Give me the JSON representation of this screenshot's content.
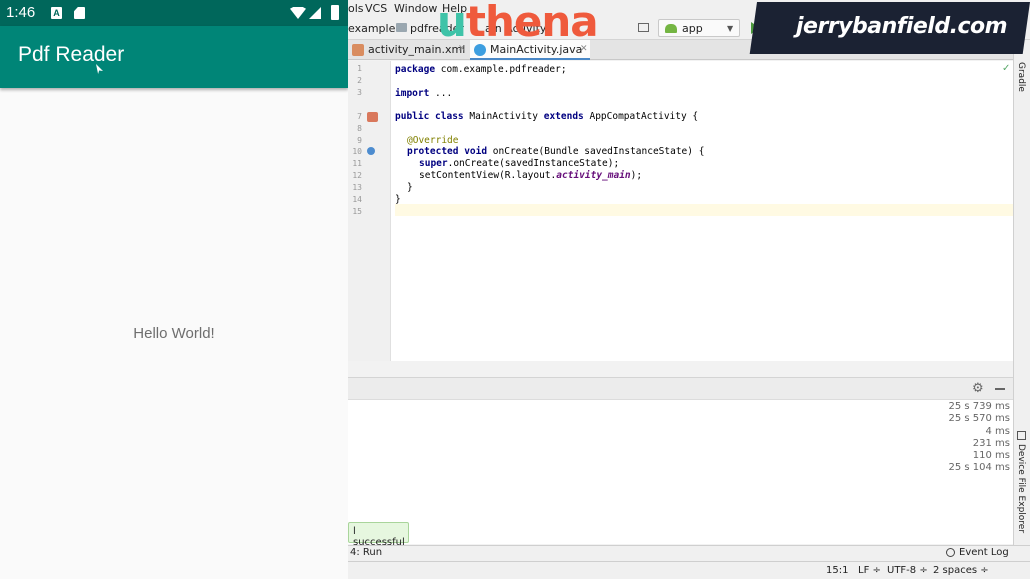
{
  "phone": {
    "time": "1:46",
    "status_a": "A",
    "app_title": "Pdf Reader",
    "hello_text": "Hello World!"
  },
  "ide": {
    "menu": [
      "ols",
      "VCS",
      "Window",
      "Help"
    ],
    "breadcrumbs": [
      "example",
      "pdfreader",
      "ain Activity"
    ],
    "run_config": "app",
    "tabs": [
      {
        "label": "activity_main.xml"
      },
      {
        "label": "MainActivity.java"
      }
    ],
    "line_numbers": [
      "1",
      "2",
      "3",
      "7",
      "8",
      "9",
      "10",
      "11",
      "12",
      "13",
      "14",
      "15"
    ],
    "code": {
      "l1_kw": "package",
      "l1_rest": " com.example.pdfreader;",
      "l3_kw": "import",
      "l3_rest": " ...",
      "l7_kw1": "public class",
      "l7_mid": " MainActivity ",
      "l7_kw2": "extends",
      "l7_rest": " AppCompatActivity {",
      "l9_ann": "@Override",
      "l10_kw": "protected void",
      "l10_rest": " onCreate(Bundle savedInstanceState) {",
      "l11_kw": "super",
      "l11_rest": ".onCreate(savedInstanceState);",
      "l12_pre": "setContentView(R.layout.",
      "l12_fld": "activity_main",
      "l12_post": ");",
      "l13": "}",
      "l14": "}"
    },
    "side_tabs": {
      "gradle": "Gradle",
      "device_explorer": "Device File Explorer"
    },
    "build_durations": [
      "25 s 739 ms",
      "25 s 570 ms",
      "4 ms",
      "231 ms",
      "110 ms",
      "25 s 104 ms"
    ],
    "toast": "l successful",
    "run_tab": "4: Run",
    "event_log": "Event Log",
    "status": {
      "position": "15:1",
      "line_sep": "LF ÷",
      "encoding": "UTF-8 ÷",
      "indent": "2 spaces ÷"
    }
  },
  "overlay": {
    "uthena": "uthena",
    "jerry": "jerrybanfield.com"
  },
  "colors": {
    "status_bar": "#00675b",
    "app_bar": "#008577",
    "uthena_u": "#3ec3a8",
    "uthena_rest": "#ef5a3c",
    "keyword": "#000080",
    "annotation": "#808000"
  }
}
